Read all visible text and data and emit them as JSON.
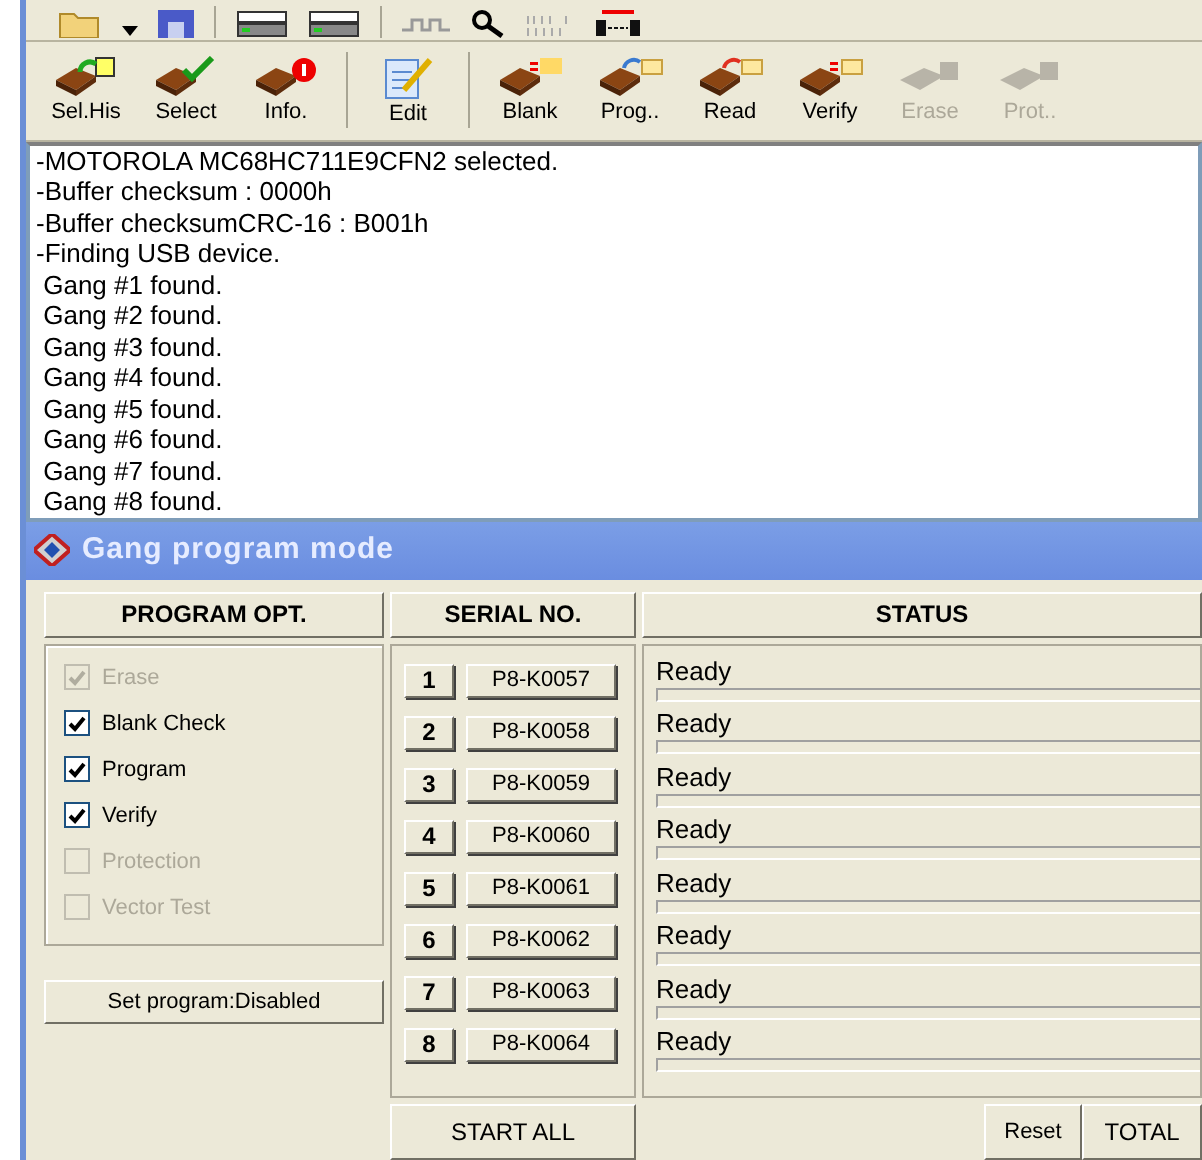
{
  "toolbar_top": {
    "items": [
      {
        "kind": "folder"
      },
      {
        "kind": "dropdown"
      },
      {
        "kind": "save"
      },
      {
        "kind": "sep"
      },
      {
        "kind": "device"
      },
      {
        "kind": "device"
      },
      {
        "kind": "sep"
      },
      {
        "kind": "wave"
      },
      {
        "kind": "search"
      },
      {
        "kind": "binary"
      },
      {
        "kind": "connector"
      }
    ]
  },
  "toolbar": {
    "items": [
      {
        "kind": "history",
        "label": "Sel.His",
        "disabled": false
      },
      {
        "kind": "select",
        "label": "Select",
        "disabled": false
      },
      {
        "kind": "info",
        "label": "Info.",
        "disabled": false
      },
      {
        "kind": "sep"
      },
      {
        "kind": "edit",
        "label": "Edit",
        "disabled": false
      },
      {
        "kind": "sep"
      },
      {
        "kind": "blank",
        "label": "Blank",
        "disabled": false
      },
      {
        "kind": "prog",
        "label": "Prog..",
        "disabled": false
      },
      {
        "kind": "read",
        "label": "Read",
        "disabled": false
      },
      {
        "kind": "verify",
        "label": "Verify",
        "disabled": false
      },
      {
        "kind": "erase",
        "label": "Erase",
        "disabled": true
      },
      {
        "kind": "protect",
        "label": "Prot..",
        "disabled": true
      }
    ]
  },
  "log": [
    "-MOTOROLA MC68HC711E9CFN2 selected.",
    "-Buffer checksum : 0000h",
    "-Buffer checksumCRC-16 : B001h",
    "-Finding USB device.",
    " Gang #1 found.",
    " Gang #2 found.",
    " Gang #3 found.",
    " Gang #4 found.",
    " Gang #5 found.",
    " Gang #6 found.",
    " Gang #7 found.",
    " Gang #8 found."
  ],
  "gang_window": {
    "title": "Gang program mode",
    "program_options": {
      "header": "PROGRAM OPT.",
      "options": [
        {
          "label": "Erase",
          "checked": true,
          "disabled": true
        },
        {
          "label": "Blank Check",
          "checked": true,
          "disabled": false
        },
        {
          "label": "Program",
          "checked": true,
          "disabled": false
        },
        {
          "label": "Verify",
          "checked": true,
          "disabled": false
        },
        {
          "label": "Protection",
          "checked": false,
          "disabled": true
        },
        {
          "label": "Vector Test",
          "checked": false,
          "disabled": true
        }
      ],
      "set_button": "Set program:Disabled"
    },
    "serial_header": "SERIAL NO.",
    "status_header": "STATUS",
    "gangs": [
      {
        "number": "1",
        "serial": "P8-K0057",
        "status": "Ready",
        "level": 0
      },
      {
        "number": "2",
        "serial": "P8-K0058",
        "status": "Ready",
        "level": 0
      },
      {
        "number": "3",
        "serial": "P8-K0059",
        "status": "Ready",
        "level": 0
      },
      {
        "number": "4",
        "serial": "P8-K0060",
        "status": "Ready",
        "level": 0
      },
      {
        "number": "5",
        "serial": "P8-K0061",
        "status": "Ready",
        "level": 0
      },
      {
        "number": "6",
        "serial": "P8-K0062",
        "status": "Ready",
        "level": 0
      },
      {
        "number": "7",
        "serial": "P8-K0063",
        "status": "Ready",
        "level": 0
      },
      {
        "number": "8",
        "serial": "P8-K0064",
        "status": "Ready",
        "level": 0
      }
    ],
    "start_all": "START ALL",
    "reset": "Reset",
    "total": "TOTAL"
  }
}
